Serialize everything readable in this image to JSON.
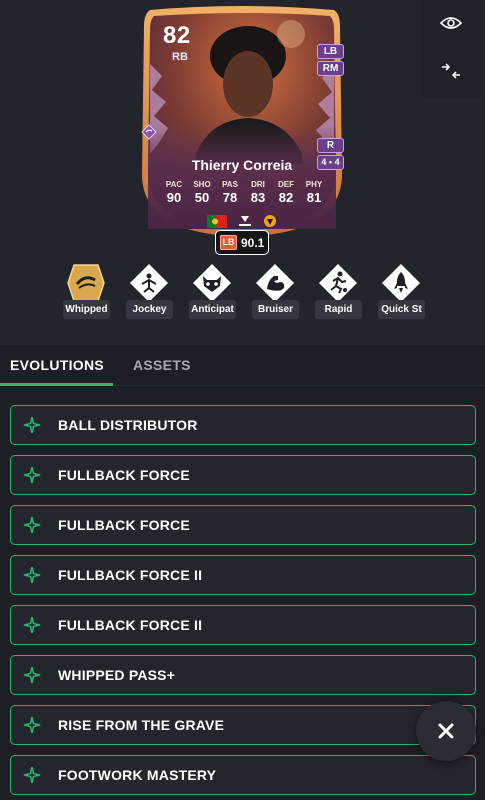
{
  "card": {
    "rating": "82",
    "position": "RB",
    "alt_positions": [
      "LB",
      "RM"
    ],
    "weak_foot_label": "R",
    "skill_label": "4 • 4",
    "name": "Thierry Correia",
    "stats": [
      {
        "label": "PAC",
        "value": "90"
      },
      {
        "label": "SHO",
        "value": "50"
      },
      {
        "label": "PAS",
        "value": "78"
      },
      {
        "label": "DRI",
        "value": "83"
      },
      {
        "label": "DEF",
        "value": "82"
      },
      {
        "label": "PHY",
        "value": "81"
      }
    ],
    "colors": {
      "frame": "#e8a24a",
      "inner": "#7a3d2c",
      "accent": "#8c4fb3"
    }
  },
  "rating_chip": {
    "position": "LB",
    "value": "90.1"
  },
  "side_actions": [
    {
      "icon": "eye-icon"
    },
    {
      "icon": "compress-arrows-icon"
    }
  ],
  "playstyles": [
    {
      "label": "Whipped",
      "icon": "whipped-pass-icon",
      "plus": true
    },
    {
      "label": "Jockey",
      "icon": "jockey-icon",
      "plus": false
    },
    {
      "label": "Anticipat",
      "icon": "anticipate-raccoon-icon",
      "plus": false
    },
    {
      "label": "Bruiser",
      "icon": "bruiser-arm-icon",
      "plus": false
    },
    {
      "label": "Rapid",
      "icon": "rapid-runner-icon",
      "plus": false
    },
    {
      "label": "Quick St",
      "icon": "quick-step-rocket-icon",
      "plus": false
    }
  ],
  "tabs": [
    {
      "label": "EVOLUTIONS",
      "active": true
    },
    {
      "label": "ASSETS",
      "active": false
    }
  ],
  "evolutions": [
    "BALL DISTRIBUTOR",
    "FULLBACK FORCE",
    "FULLBACK FORCE",
    "FULLBACK FORCE II",
    "FULLBACK FORCE II",
    "WHIPPED PASS+",
    "RISE FROM THE GRAVE",
    "FOOTWORK MASTERY"
  ],
  "theme": {
    "accent_green": "#2fb36b",
    "background": "#1c1f26",
    "chip_red": "#e85a38"
  }
}
